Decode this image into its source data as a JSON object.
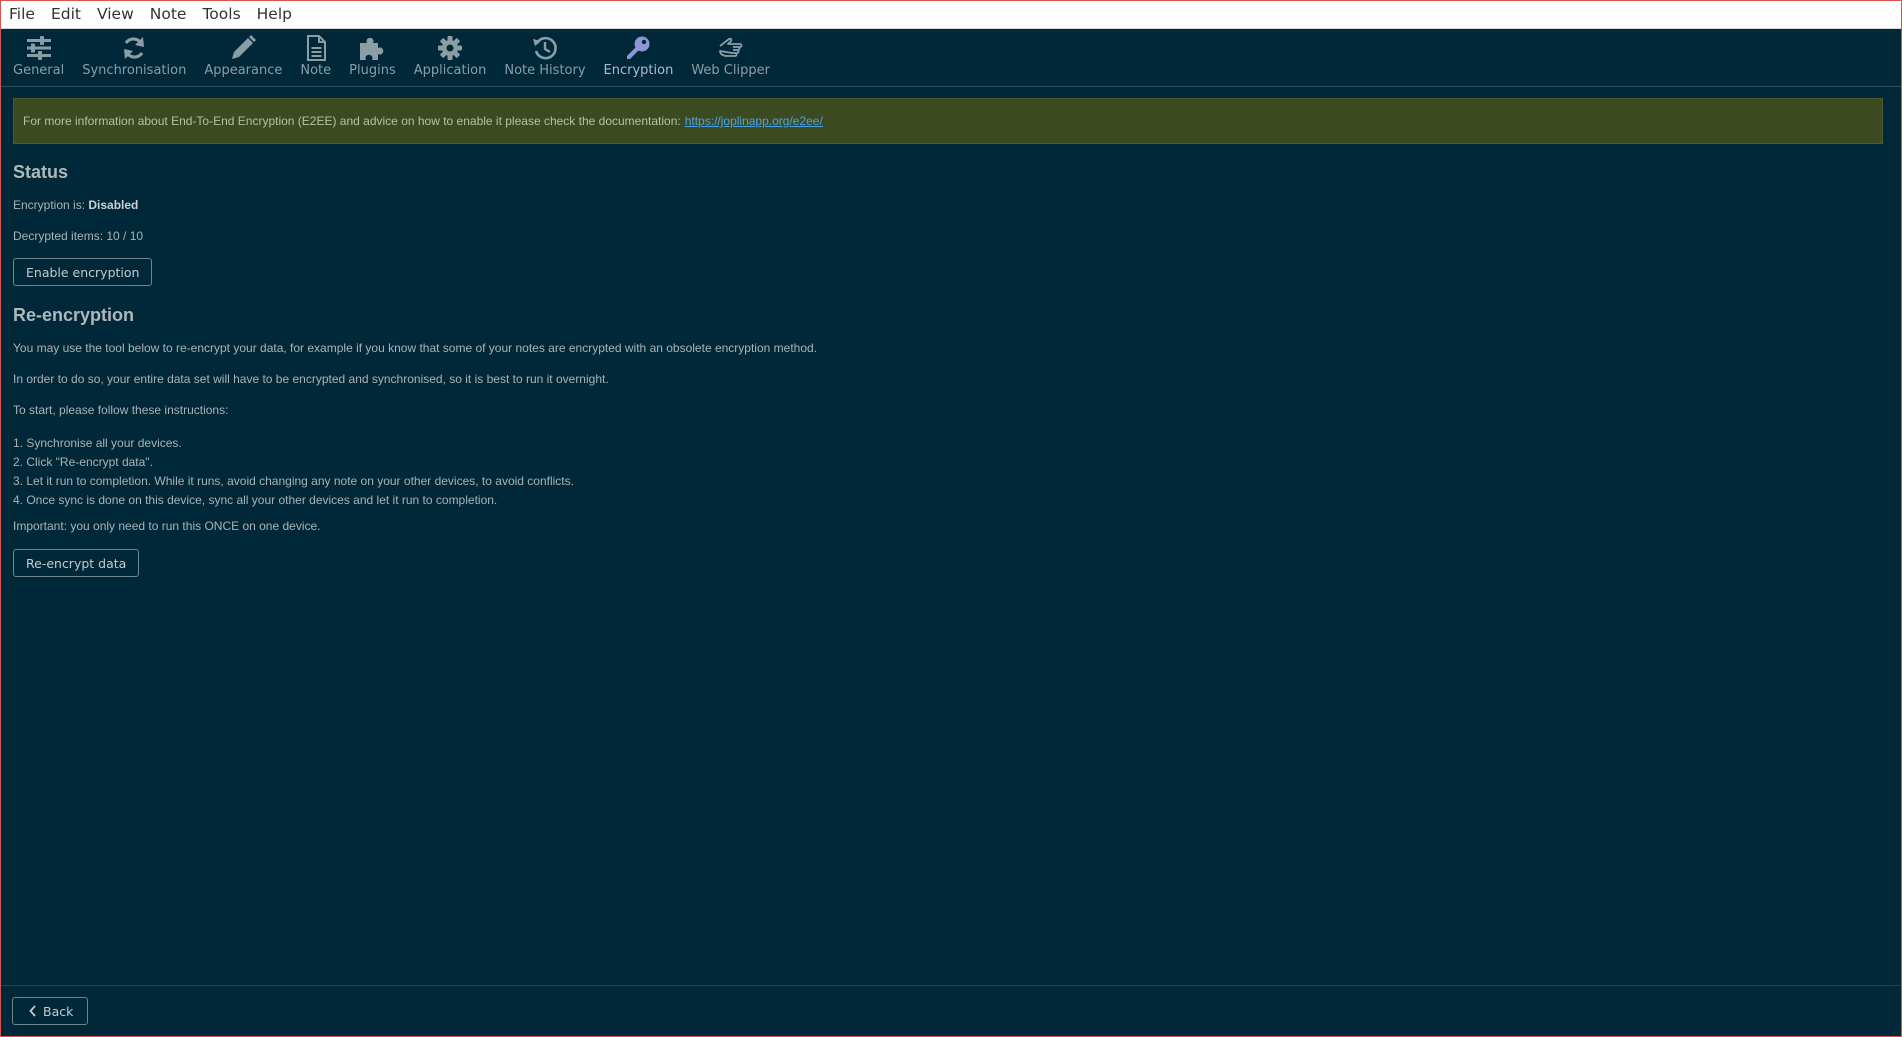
{
  "menubar": {
    "items": [
      "File",
      "Edit",
      "View",
      "Note",
      "Tools",
      "Help"
    ]
  },
  "tabs": [
    {
      "label": "General",
      "icon": "sliders-icon",
      "active": false
    },
    {
      "label": "Synchronisation",
      "icon": "sync-icon",
      "active": false
    },
    {
      "label": "Appearance",
      "icon": "pencil-icon",
      "active": false
    },
    {
      "label": "Note",
      "icon": "document-icon",
      "active": false
    },
    {
      "label": "Plugins",
      "icon": "puzzle-icon",
      "active": false
    },
    {
      "label": "Application",
      "icon": "gear-icon",
      "active": false
    },
    {
      "label": "Note History",
      "icon": "history-icon",
      "active": false
    },
    {
      "label": "Encryption",
      "icon": "key-icon",
      "active": true
    },
    {
      "label": "Web Clipper",
      "icon": "hand-icon",
      "active": false
    }
  ],
  "banner": {
    "text": "For more information about End-To-End Encryption (E2EE) and advice on how to enable it please check the documentation:",
    "link": "https://joplinapp.org/e2ee/"
  },
  "status": {
    "heading": "Status",
    "encryption_prefix": "Encryption is:",
    "encryption_value": "Disabled",
    "decrypted_items": "Decrypted items: 10 / 10",
    "enable_button": "Enable encryption"
  },
  "reencryption": {
    "heading": "Re-encryption",
    "para1": "You may use the tool below to re-encrypt your data, for example if you know that some of your notes are encrypted with an obsolete encryption method.",
    "para2": "In order to do so, your entire data set will have to be encrypted and synchronised, so it is best to run it overnight.",
    "para3": "To start, please follow these instructions:",
    "steps": [
      "1. Synchronise all your devices.",
      "2. Click \"Re-encrypt data\".",
      "3. Let it run to completion. While it runs, avoid changing any note on your other devices, to avoid conflicts.",
      "4. Once sync is done on this device, sync all your other devices and let it run to completion."
    ],
    "important": "Important: you only need to run this ONCE on one device.",
    "button": "Re-encrypt data"
  },
  "footer": {
    "back_label": "Back",
    "back_icon": "chevron-left-icon"
  },
  "colors": {
    "background": "#002838",
    "banner": "#3c4a22",
    "link": "#4aa3e6",
    "active_tab": "#b7c4ea",
    "window_border": "#d9534f"
  }
}
